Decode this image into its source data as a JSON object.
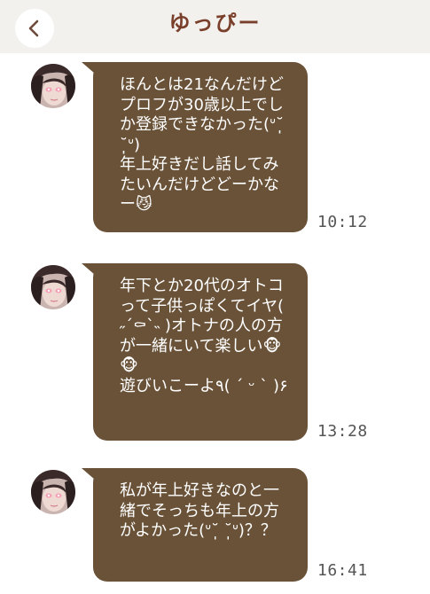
{
  "header": {
    "title": "ゆっぴー",
    "back_icon": "chevron-left-icon"
  },
  "messages": [
    {
      "text": "ほんとは21なんだけどプロフが30歳以上でしか登録できなかった(ᐡ˘̩̩̩ ˘̩̩̩ᐡ)\n年上好きだし話してみたいんだけどどーかなー😼",
      "time": "10:12"
    },
    {
      "text": "年下とか20代のオトコって子供っぽくてイヤ( ˶´⚰︎`˵ )オトナの人の方が一緒にいて楽しい🐵🐵\n遊びいこーよ٩( ´ ᵕ ` )۶",
      "time": "13:28"
    },
    {
      "text": "私が年上好きなのと一緒でそっちも年上の方がよかった(ᐡ˘̩̩̩ ˘̩̩̩ᐡ)？？",
      "time": "16:41"
    }
  ],
  "colors": {
    "bubble": "#6a5238",
    "title": "#7a3f2a",
    "header_bg": "#f3f1ee"
  }
}
